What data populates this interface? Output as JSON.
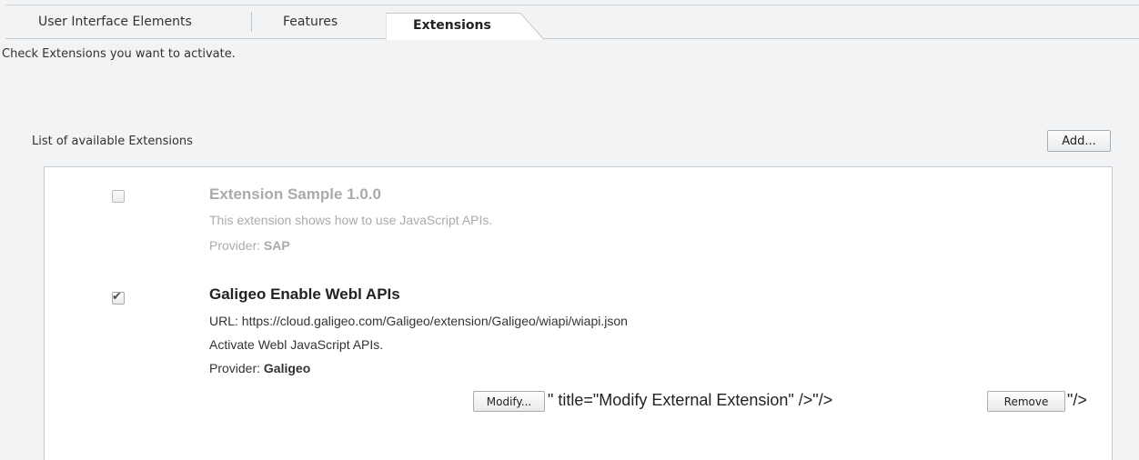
{
  "tabs": [
    {
      "label": "User Interface Elements",
      "active": false
    },
    {
      "label": "Features",
      "active": false
    },
    {
      "label": "Extensions",
      "active": true
    }
  ],
  "instruction": "Check Extensions you want to activate.",
  "list": {
    "label": "List of available Extensions",
    "add_button": "Add..."
  },
  "extensions": [
    {
      "checked": false,
      "enabled": false,
      "title": "Extension Sample 1.0.0",
      "description": "This extension shows how to use JavaScript APIs.",
      "provider_prefix": "Provider:",
      "provider": "SAP"
    },
    {
      "checked": true,
      "enabled": true,
      "title": "Galigeo Enable Webl APIs",
      "url_line": "URL: https://cloud.galigeo.com/Galigeo/extension/Galigeo/wiapi/wiapi.json",
      "description": "Activate Webl JavaScript APIs.",
      "provider_prefix": "Provider:",
      "provider": "Galigeo",
      "modify_button": "Modify...",
      "modify_trailing": "\" title=\"Modify External Extension\" />\"/>",
      "remove_button": "Remove",
      "remove_trailing": "\"/>"
    }
  ]
}
